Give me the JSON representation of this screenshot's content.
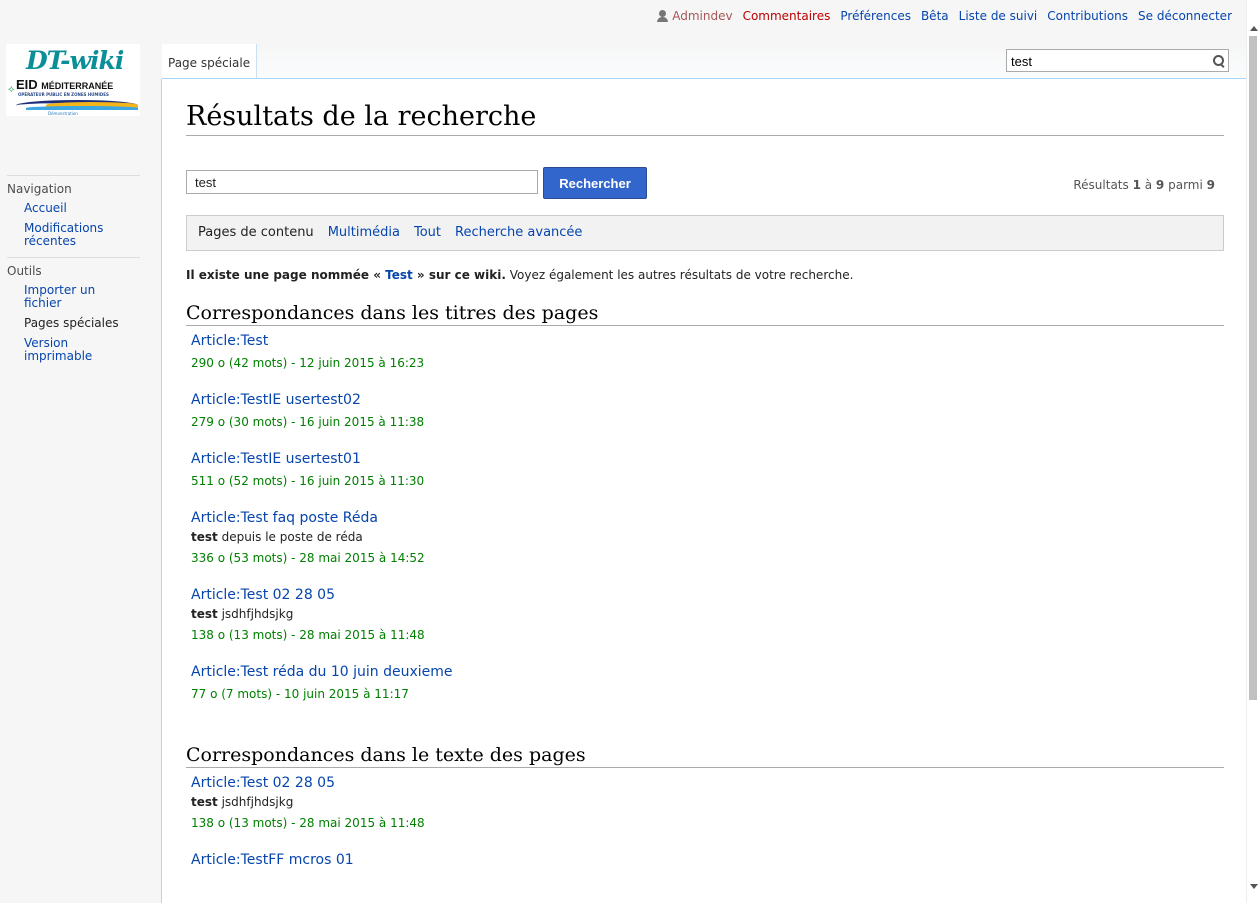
{
  "personal": {
    "user": "Admindev",
    "comments": "Commentaires",
    "preferences": "Préférences",
    "beta": "Bêta",
    "watchlist": "Liste de suivi",
    "contributions": "Contributions",
    "logout": "Se déconnecter"
  },
  "logo": {
    "title": "DT-wiki",
    "org": "EID",
    "org2": "MÉDITERRANÉE",
    "tagline": "OPÉRATEUR PUBLIC EN ZONES HUMIDES",
    "mode": "Démonstration"
  },
  "tab": {
    "label": "Page spéciale"
  },
  "top_search": {
    "value": "test"
  },
  "sidebar": {
    "navigation": {
      "heading": "Navigation",
      "items": [
        "Accueil",
        "Modifications récentes"
      ]
    },
    "tools": {
      "heading": "Outils",
      "items": [
        "Importer un fichier",
        "Pages spéciales",
        "Version imprimable"
      ]
    }
  },
  "page": {
    "title": "Résultats de la recherche",
    "search_value": "test",
    "search_button": "Rechercher",
    "results_prefix": "Résultats ",
    "results_from": "1",
    "results_to_word": " à ",
    "results_to": "9",
    "results_of_word": " parmi ",
    "results_total": "9",
    "profiles": [
      "Pages de contenu",
      "Multimédia",
      "Tout",
      "Recherche avancée"
    ],
    "exists_prefix": "Il existe une page nommée « ",
    "exists_link": "Test",
    "exists_suffix": " » sur ce wiki.",
    "exists_more": " Voyez également les autres résultats de votre recherche."
  },
  "title_matches": {
    "heading": "Correspondances dans les titres des pages",
    "results": [
      {
        "title": "Article:Test",
        "snippet_bold": "",
        "snippet": "",
        "meta": "290 o (42 mots) - 12 juin 2015 à 16:23"
      },
      {
        "title": "Article:TestIE usertest02",
        "snippet_bold": "",
        "snippet": "",
        "meta": "279 o (30 mots) - 16 juin 2015 à 11:38"
      },
      {
        "title": "Article:TestIE usertest01",
        "snippet_bold": "",
        "snippet": "",
        "meta": "511 o (52 mots) - 16 juin 2015 à 11:30"
      },
      {
        "title": "Article:Test faq poste Réda",
        "snippet_bold": "test",
        "snippet": " depuis le poste de réda",
        "meta": "336 o (53 mots) - 28 mai 2015 à 14:52"
      },
      {
        "title": "Article:Test 02 28 05",
        "snippet_bold": "test",
        "snippet": " jsdhfjhdsjkg",
        "meta": "138 o (13 mots) - 28 mai 2015 à 11:48"
      },
      {
        "title": "Article:Test réda du 10 juin deuxieme",
        "snippet_bold": "",
        "snippet": "",
        "meta": "77 o (7 mots) - 10 juin 2015 à 11:17"
      }
    ]
  },
  "text_matches": {
    "heading": "Correspondances dans le texte des pages",
    "results": [
      {
        "title": "Article:Test 02 28 05",
        "snippet_bold": "test",
        "snippet": " jsdhfjhdsjkg",
        "meta": "138 o (13 mots) - 28 mai 2015 à 11:48"
      },
      {
        "title": "Article:TestFF mcros 01",
        "snippet_bold": "",
        "snippet": "",
        "meta": ""
      }
    ]
  },
  "colors": {
    "link": "#0645ad",
    "meta": "#008000",
    "button": "#3366cc",
    "border": "#a7d7f9"
  }
}
